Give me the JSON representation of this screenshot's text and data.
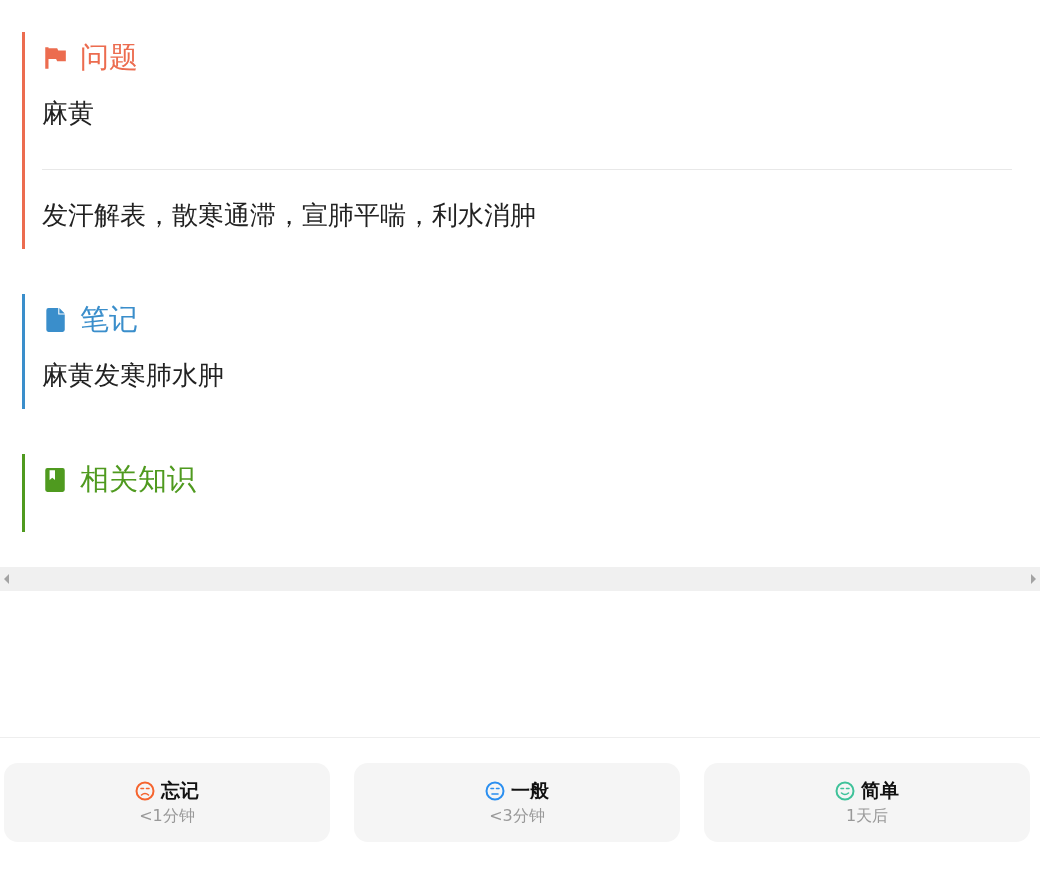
{
  "sections": [
    {
      "kind": "question",
      "title": "问题",
      "color": "#ec6c4f",
      "front": "麻黄",
      "back": "发汗解表，散寒通滞，宣肺平喘，利水消肿"
    },
    {
      "kind": "note",
      "title": "笔记",
      "color": "#3a8ecb",
      "text": "麻黄发寒肺水肿"
    },
    {
      "kind": "related",
      "title": "相关知识",
      "color": "#4f9a1f"
    }
  ],
  "answer_buttons": [
    {
      "kind": "forgot",
      "label": "忘记",
      "interval": "<1分钟",
      "color": "#f5642e"
    },
    {
      "kind": "normal",
      "label": "一般",
      "interval": "<3分钟",
      "color": "#2b8ff0"
    },
    {
      "kind": "easy",
      "label": "简单",
      "interval": "1天后",
      "color": "#3fc29a"
    }
  ]
}
